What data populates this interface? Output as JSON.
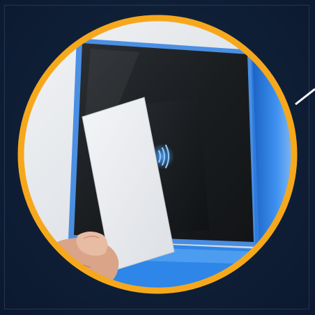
{
  "photo": {
    "subject": "hand-holding-card-at-rfid-reader",
    "reader_accent": "#2f7fe0",
    "ring_color": "#f6a81c",
    "background": "#0f1f36",
    "icon": "contactless-icon"
  }
}
